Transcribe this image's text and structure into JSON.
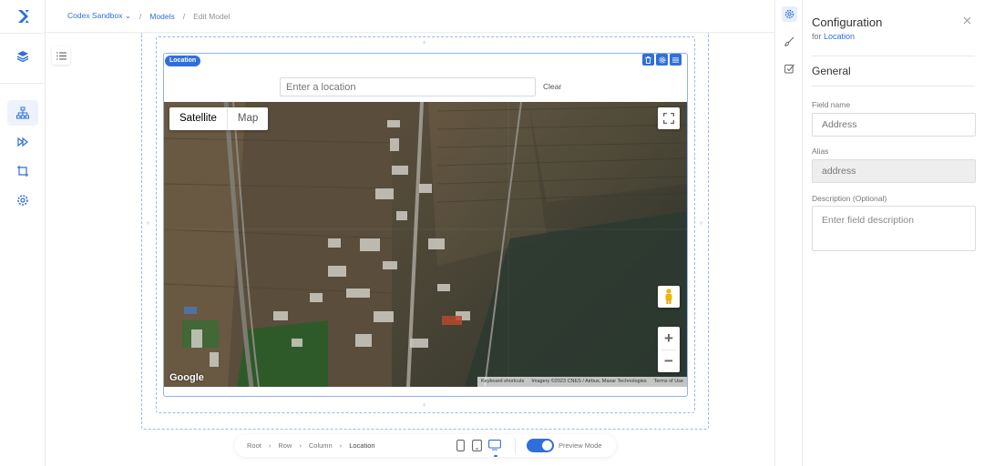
{
  "breadcrumb": {
    "workspace": "Codex Sandbox",
    "workspace_caret": "⌄",
    "sep": "/",
    "models": "Models",
    "current": "Edit Model"
  },
  "field": {
    "tag": "Location",
    "search_placeholder": "Enter a location",
    "clear_label": "Clear"
  },
  "map": {
    "satellite_label": "Satellite",
    "map_label": "Map",
    "zoom_in": "+",
    "zoom_out": "−",
    "google": "Google",
    "keyboard_shortcuts": "Keyboard shortcuts",
    "imagery": "Imagery ©2023 CNES / Airbus, Maxar Technologies",
    "terms": "Terms of Use"
  },
  "bottom_bar": {
    "crumbs": [
      "Root",
      "Row",
      "Column",
      "Location"
    ],
    "preview_label": "Preview Mode",
    "preview_on": true
  },
  "panel": {
    "title": "Configuration",
    "for_prefix": "for",
    "for_target": "Location",
    "section": "General",
    "field_name_label": "Field name",
    "field_name_value": "Address",
    "alias_label": "Alias",
    "alias_value": "address",
    "description_label": "Description (Optional)",
    "description_placeholder": "Enter field description"
  },
  "colors": {
    "accent": "#2f6fdc",
    "dashed_outline": "#9cb8ea"
  }
}
